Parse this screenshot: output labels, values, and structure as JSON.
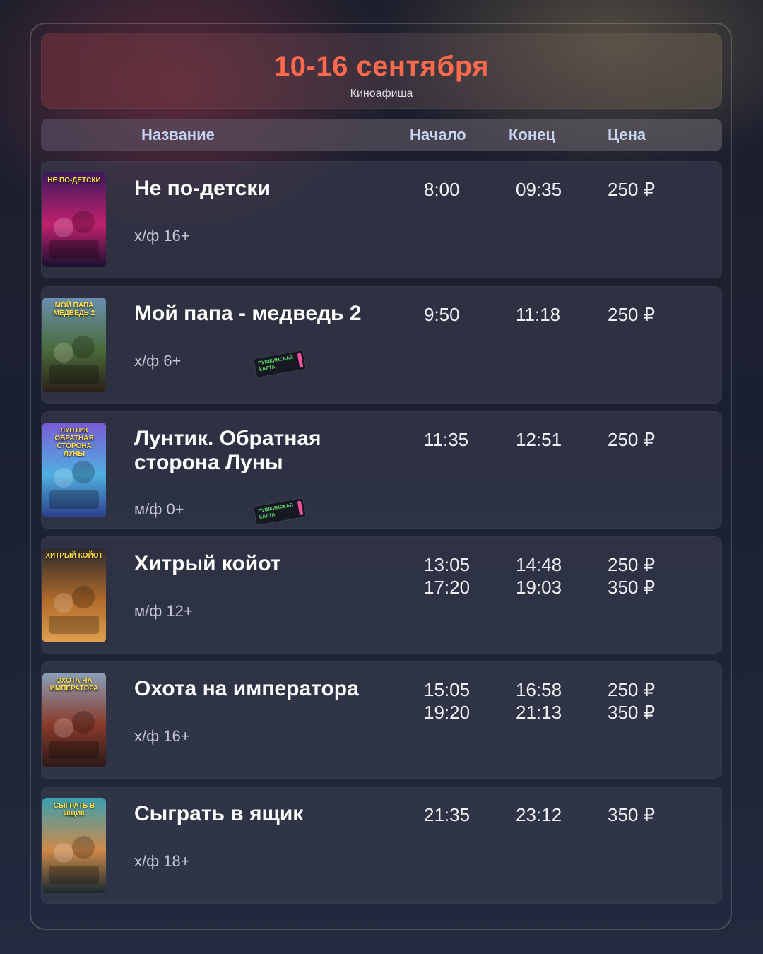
{
  "header": {
    "title": "10-16 сентября",
    "subtitle": "Киноафиша"
  },
  "columns": {
    "name": "Название",
    "start": "Начало",
    "end": "Конец",
    "price": "Цена"
  },
  "pushkin_card_label": "ПУШКИНСКАЯ КАРТА",
  "colors": {
    "accent": "#ff6a4d",
    "header_text": "#c9d3f2",
    "pushkin_stripe": "#ff4fa3",
    "pushkin_text": "#63e06a"
  },
  "movies": [
    {
      "title": "Не по-детски",
      "meta": "х/ф 16+",
      "starts": [
        "8:00"
      ],
      "ends": [
        "09:35"
      ],
      "prices": [
        "250 ₽"
      ],
      "pushkin": false,
      "poster_text": "НЕ ПО-ДЕТСКИ",
      "poster_colors": [
        "#3a1a5c",
        "#c1206e",
        "#1a1030"
      ]
    },
    {
      "title": "Мой папа - медведь 2",
      "meta": "х/ф 6+",
      "starts": [
        "9:50"
      ],
      "ends": [
        "11:18"
      ],
      "prices": [
        "250 ₽"
      ],
      "pushkin": true,
      "poster_text": "МОЙ ПАПА МЕДВЕДЬ 2",
      "poster_colors": [
        "#6b8fb0",
        "#4a6b3a",
        "#2a2018"
      ]
    },
    {
      "title": "Лунтик. Обратная сторона Луны",
      "meta": "м/ф 0+",
      "starts": [
        "11:35"
      ],
      "ends": [
        "12:51"
      ],
      "prices": [
        "250 ₽"
      ],
      "pushkin": true,
      "poster_text": "ЛУНТИК ОБРАТНАЯ СТОРОНА ЛУНЫ",
      "poster_colors": [
        "#7a5bd6",
        "#4fb0e0",
        "#2c3f8a"
      ]
    },
    {
      "title": "Хитрый койот",
      "meta": "м/ф 12+",
      "starts": [
        "13:05",
        "17:20"
      ],
      "ends": [
        "14:48",
        "19:03"
      ],
      "prices": [
        "250 ₽",
        "350 ₽"
      ],
      "pushkin": false,
      "poster_text": "ХИТРЫЙ КОЙОТ",
      "poster_colors": [
        "#2b2a2e",
        "#b06a2a",
        "#e0a050"
      ]
    },
    {
      "title": "Охота на императора",
      "meta": "х/ф 16+",
      "starts": [
        "15:05",
        "19:20"
      ],
      "ends": [
        "16:58",
        "21:13"
      ],
      "prices": [
        "250 ₽",
        "350 ₽"
      ],
      "pushkin": false,
      "poster_text": "ОХОТА НА ИМПЕРАТОРА",
      "poster_colors": [
        "#8aa0b8",
        "#8a3a2a",
        "#2a1a18"
      ]
    },
    {
      "title": "Сыграть в ящик",
      "meta": "х/ф 18+",
      "starts": [
        "21:35"
      ],
      "ends": [
        "23:12"
      ],
      "prices": [
        "350 ₽"
      ],
      "pushkin": false,
      "poster_text": "СЫГРАТЬ В ЯЩИК",
      "poster_colors": [
        "#3aa0b0",
        "#d08a4a",
        "#1a2a30"
      ]
    }
  ]
}
